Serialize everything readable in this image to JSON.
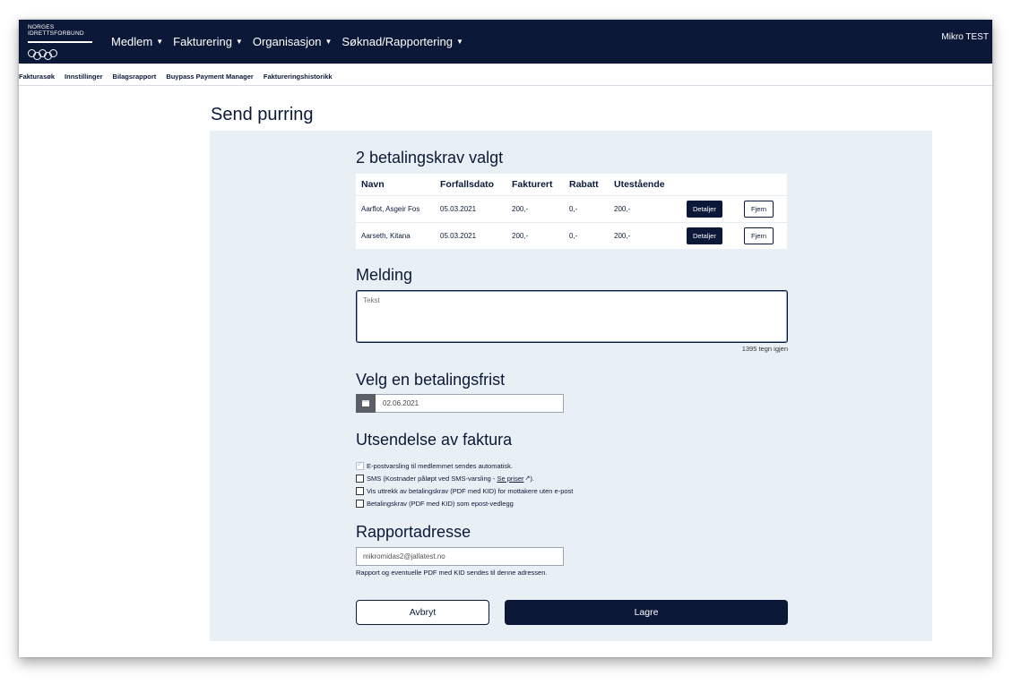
{
  "header": {
    "logo_line1": "NORGES",
    "logo_line2": "IDRETTSFORBUND",
    "menu": [
      {
        "label": "Medlem"
      },
      {
        "label": "Fakturering"
      },
      {
        "label": "Organisasjon"
      },
      {
        "label": "Søknad/Rapportering"
      }
    ],
    "user": "Mikro TEST"
  },
  "subnav": [
    "Fakturasøk",
    "Innstillinger",
    "Bilagsrapport",
    "Buypass Payment Manager",
    "Faktureringshistorikk"
  ],
  "page_title": "Send purring",
  "selected": {
    "title": "2 betalingskrav valgt",
    "columns": [
      "Navn",
      "Forfallsdato",
      "Fakturert",
      "Rabatt",
      "Utestående"
    ],
    "rows": [
      {
        "navn": "Aarflot, Asgeir Fos",
        "forfall": "05.03.2021",
        "fakturert": "200,-",
        "rabatt": "0,-",
        "utestaende": "200,-",
        "details": "Detaljer",
        "remove": "Fjern"
      },
      {
        "navn": "Aarseth, Kitana",
        "forfall": "05.03.2021",
        "fakturert": "200,-",
        "rabatt": "0,-",
        "utestaende": "200,-",
        "details": "Detaljer",
        "remove": "Fjern"
      }
    ]
  },
  "message": {
    "title": "Melding",
    "placeholder": "Tekst",
    "counter": "1395 tegn igjen"
  },
  "deadline": {
    "title": "Velg en betalingsfrist",
    "value": "02.06.2021"
  },
  "dispatch": {
    "title": "Utsendelse av faktura",
    "options": [
      {
        "label": "E-postvarsling til medlemmet sendes automatisk.",
        "checked": true
      },
      {
        "label": "SMS (Kostnader påløpt ved SMS-varsling - ",
        "link": "Se priser",
        "suffix": ").",
        "checked": false
      },
      {
        "label": "Vis uttrekk av betalingskrav (PDF med KID) for mottakere uten e-post",
        "checked": false
      },
      {
        "label": "Betalingskrav (PDF med KID) som epost-vedlegg",
        "checked": false
      }
    ]
  },
  "report": {
    "title": "Rapportadresse",
    "email": "mikromidas2@jallatest.no",
    "help": "Rapport og eventuelle PDF med KID sendes til denne adressen."
  },
  "actions": {
    "cancel": "Avbryt",
    "save": "Lagre"
  }
}
